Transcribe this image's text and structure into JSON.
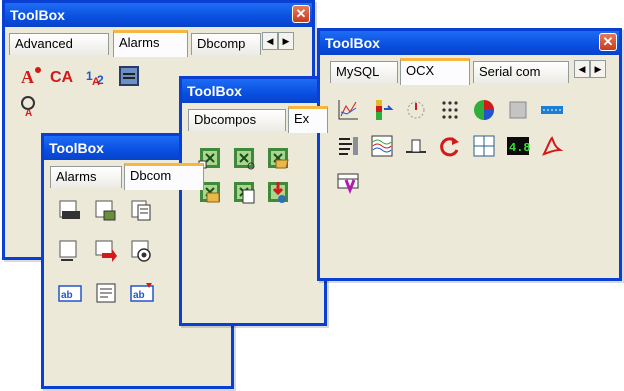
{
  "window_1": {
    "title": "ToolBox",
    "tabs": [
      "Advanced",
      "Alarms",
      "Dbcomp"
    ],
    "icon_text": [
      "A",
      "CA",
      "1",
      "2"
    ]
  },
  "window_2": {
    "title": "ToolBox",
    "tabs": [
      "Alarms",
      "Dbcom"
    ],
    "icon_text": [
      "ab",
      "ab"
    ]
  },
  "window_3": {
    "title": "ToolBox",
    "tabs": [
      "Dbcompos",
      "Ex"
    ]
  },
  "window_4": {
    "title": "ToolBox",
    "tabs": [
      "MySQL",
      "OCX",
      "Serial com"
    ],
    "icon_text": [
      "4.8"
    ]
  },
  "scroll_glyphs": {
    "left": "◀",
    "right": "▶"
  },
  "close_glyph": "✕",
  "colors": {
    "title_bar": "#0a4fe0",
    "window_border": "#0a3fd4",
    "face": "#ece9d8",
    "active_tab_accent": "#f5b740"
  }
}
